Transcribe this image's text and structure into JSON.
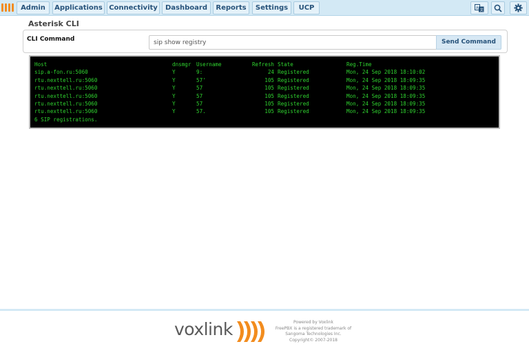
{
  "nav": {
    "items": [
      {
        "label": "Admin"
      },
      {
        "label": "Applications"
      },
      {
        "label": "Connectivity"
      },
      {
        "label": "Dashboard"
      },
      {
        "label": "Reports"
      },
      {
        "label": "Settings"
      },
      {
        "label": "UCP"
      }
    ],
    "icons": [
      "language-icon",
      "search-icon",
      "gear-icon"
    ]
  },
  "page": {
    "title": "Asterisk CLI"
  },
  "cli": {
    "label": "CLI Command",
    "input_value": "sip show registry",
    "send_label": "Send Command"
  },
  "output": {
    "header": {
      "host": "Host",
      "dnsmgr": "dnsmgr",
      "username": "Username",
      "refresh": "Refresh",
      "state": "State",
      "regtime": "Reg.Time"
    },
    "rows": [
      {
        "host": "sip.a-fon.ru:5060",
        "dnsmgr": "Y",
        "username": "9:",
        "refresh": "24",
        "state": "Registered",
        "regtime": "Mon, 24 Sep 2018 18:10:02"
      },
      {
        "host": "rtu.nexttell.ru:5060",
        "dnsmgr": "Y",
        "username": "57'",
        "refresh": "105",
        "state": "Registered",
        "regtime": "Mon, 24 Sep 2018 18:09:35"
      },
      {
        "host": "rtu.nexttell.ru:5060",
        "dnsmgr": "Y",
        "username": "57",
        "refresh": "105",
        "state": "Registered",
        "regtime": "Mon, 24 Sep 2018 18:09:35"
      },
      {
        "host": "rtu.nexttell.ru:5060",
        "dnsmgr": "Y",
        "username": "57",
        "refresh": "105",
        "state": "Registered",
        "regtime": "Mon, 24 Sep 2018 18:09:35"
      },
      {
        "host": "rtu.nexttell.ru:5060",
        "dnsmgr": "Y",
        "username": "57",
        "refresh": "105",
        "state": "Registered",
        "regtime": "Mon, 24 Sep 2018 18:09:35"
      },
      {
        "host": "rtu.nexttell.ru:5060",
        "dnsmgr": "Y",
        "username": "57.",
        "refresh": "105",
        "state": "Registered",
        "regtime": "Mon, 24 Sep 2018 18:09:35"
      }
    ],
    "summary": "6 SIP registrations."
  },
  "footer": {
    "brand": "voxlink",
    "lines": [
      "Powered by Voxlink",
      "FreePBX is a registered trademark of",
      "Sangoma Technologies Inc.",
      "Copyright© 2007-2018"
    ]
  },
  "colors": {
    "accent": "#26527a",
    "terminal_text": "#2fd12f",
    "brand_orange": "#f28c1e"
  }
}
